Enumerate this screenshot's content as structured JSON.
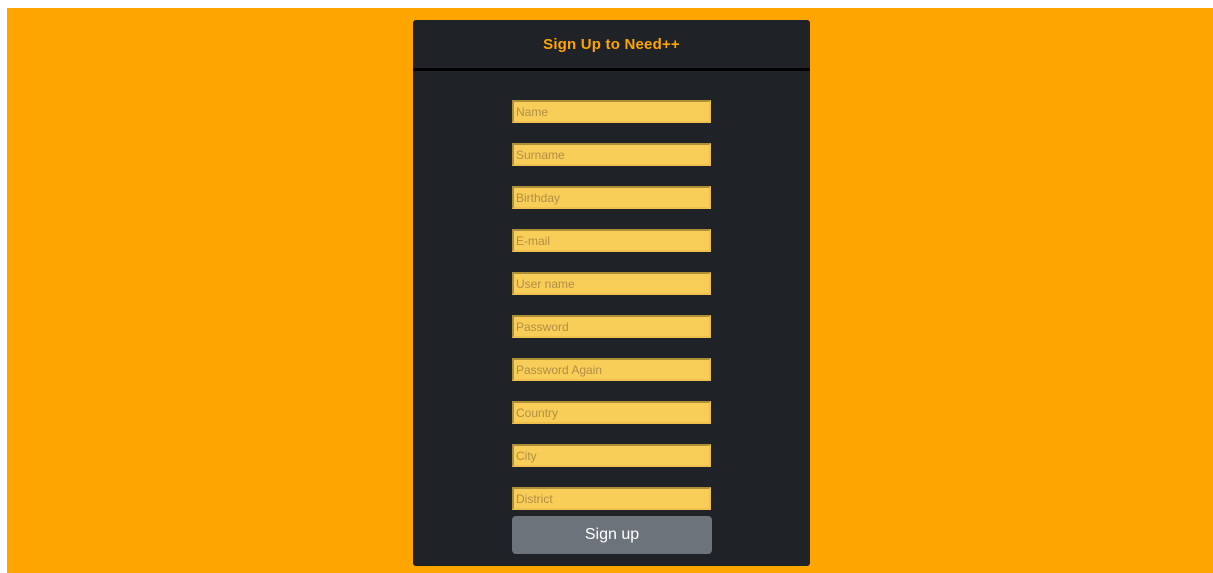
{
  "form": {
    "title": "Sign Up to Need++",
    "fields": [
      {
        "placeholder": "Name",
        "value": ""
      },
      {
        "placeholder": "Surname",
        "value": ""
      },
      {
        "placeholder": "Birthday",
        "value": ""
      },
      {
        "placeholder": "E-mail",
        "value": ""
      },
      {
        "placeholder": "User name",
        "value": ""
      },
      {
        "placeholder": "Password",
        "value": ""
      },
      {
        "placeholder": "Password Again",
        "value": ""
      },
      {
        "placeholder": "Country",
        "value": ""
      },
      {
        "placeholder": "City",
        "value": ""
      },
      {
        "placeholder": "District",
        "value": ""
      }
    ],
    "submit_label": "Sign up"
  },
  "colors": {
    "page_background": "#ffa500",
    "card_background": "#1f2226",
    "title_color": "#ffa500",
    "field_background": "#f8cd58",
    "button_background": "#6c737b"
  }
}
